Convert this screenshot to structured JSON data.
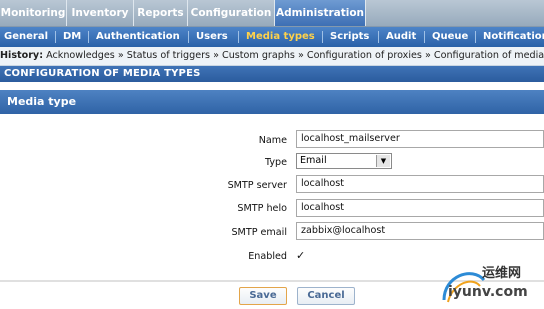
{
  "main_nav": {
    "tabs": [
      {
        "label": "Monitoring",
        "active": false
      },
      {
        "label": "Inventory",
        "active": false
      },
      {
        "label": "Reports",
        "active": false
      },
      {
        "label": "Configuration",
        "active": false
      },
      {
        "label": "Administration",
        "active": true
      }
    ]
  },
  "sub_nav": {
    "items": [
      {
        "label": "General",
        "active": false
      },
      {
        "label": "DM",
        "active": false
      },
      {
        "label": "Authentication",
        "active": false
      },
      {
        "label": "Users",
        "active": false
      },
      {
        "label": "Media types",
        "active": true
      },
      {
        "label": "Scripts",
        "active": false
      },
      {
        "label": "Audit",
        "active": false
      },
      {
        "label": "Queue",
        "active": false
      },
      {
        "label": "Notifications",
        "active": false
      }
    ]
  },
  "history": {
    "label": "History:",
    "text": "Acknowledges » Status of triggers » Custom graphs » Configuration of proxies » Configuration of media types"
  },
  "page_title": "CONFIGURATION OF MEDIA TYPES",
  "form": {
    "header": "Media type",
    "fields": {
      "name": {
        "label": "Name",
        "value": "localhost_mailserver"
      },
      "type": {
        "label": "Type",
        "value": "Email"
      },
      "smtp_server": {
        "label": "SMTP server",
        "value": "localhost"
      },
      "smtp_helo": {
        "label": "SMTP helo",
        "value": "localhost"
      },
      "smtp_email": {
        "label": "SMTP email",
        "value": "zabbix@localhost"
      },
      "enabled": {
        "label": "Enabled",
        "checked": true
      }
    },
    "save_label": "Save",
    "cancel_label": "Cancel"
  },
  "watermark": {
    "cn": "运维网",
    "domain": "iyunv.com"
  },
  "colors": {
    "nav_active": "#3d6fb4",
    "subnav_bg": "#2a61a8",
    "subnav_active_text": "#ffd24a",
    "save_border": "#e3a54a"
  }
}
